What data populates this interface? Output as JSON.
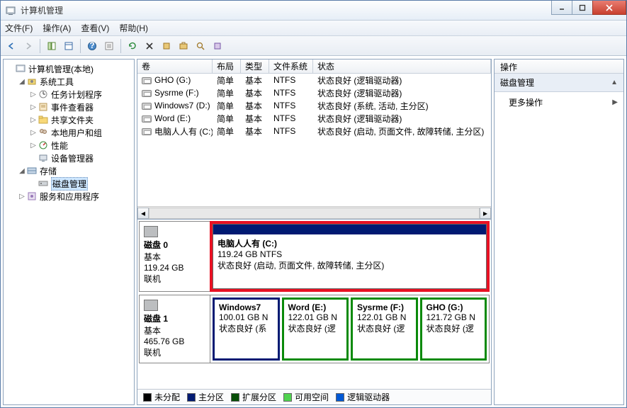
{
  "window": {
    "title": "计算机管理"
  },
  "menu": {
    "file": "文件(F)",
    "action": "操作(A)",
    "view": "查看(V)",
    "help": "帮助(H)"
  },
  "tree": {
    "root": "计算机管理(本地)",
    "systools": "系统工具",
    "sched": "任务计划程序",
    "event": "事件查看器",
    "shared": "共享文件夹",
    "users": "本地用户和组",
    "perf": "性能",
    "devmgr": "设备管理器",
    "storage": "存储",
    "diskmgmt": "磁盘管理",
    "services": "服务和应用程序"
  },
  "columns": {
    "vol": "卷",
    "layout": "布局",
    "type": "类型",
    "fs": "文件系统",
    "status": "状态"
  },
  "volumes": [
    {
      "name": "GHO (G:)",
      "layout": "简单",
      "type": "基本",
      "fs": "NTFS",
      "status": "状态良好 (逻辑驱动器)"
    },
    {
      "name": "Sysrme (F:)",
      "layout": "简单",
      "type": "基本",
      "fs": "NTFS",
      "status": "状态良好 (逻辑驱动器)"
    },
    {
      "name": "Windows7 (D:)",
      "layout": "简单",
      "type": "基本",
      "fs": "NTFS",
      "status": "状态良好 (系统, 活动, 主分区)"
    },
    {
      "name": "Word (E:)",
      "layout": "简单",
      "type": "基本",
      "fs": "NTFS",
      "status": "状态良好 (逻辑驱动器)"
    },
    {
      "name": "电脑人人有 (C:)",
      "layout": "简单",
      "type": "基本",
      "fs": "NTFS",
      "status": "状态良好 (启动, 页面文件, 故障转储, 主分区)"
    }
  ],
  "disk0": {
    "label": "磁盘 0",
    "basic": "基本",
    "size": "119.24 GB",
    "online": "联机",
    "part": {
      "name": "电脑人人有  (C:)",
      "detail": "119.24 GB NTFS",
      "status": "状态良好 (启动, 页面文件, 故障转储, 主分区)"
    }
  },
  "disk1": {
    "label": "磁盘 1",
    "basic": "基本",
    "size": "465.76 GB",
    "online": "联机",
    "parts": [
      {
        "name": "Windows7",
        "detail": "100.01 GB N",
        "status": "状态良好 (系"
      },
      {
        "name": "Word  (E:)",
        "detail": "122.01 GB N",
        "status": "状态良好 (逻"
      },
      {
        "name": "Sysrme  (F:)",
        "detail": "122.01 GB N",
        "status": "状态良好 (逻"
      },
      {
        "name": "GHO  (G:)",
        "detail": "121.72 GB N",
        "status": "状态良好 (逻"
      }
    ]
  },
  "legend": {
    "unalloc": "未分配",
    "primary": "主分区",
    "ext": "扩展分区",
    "free": "可用空间",
    "logical": "逻辑驱动器"
  },
  "actions": {
    "header": "操作",
    "section": "磁盘管理",
    "more": "更多操作"
  }
}
